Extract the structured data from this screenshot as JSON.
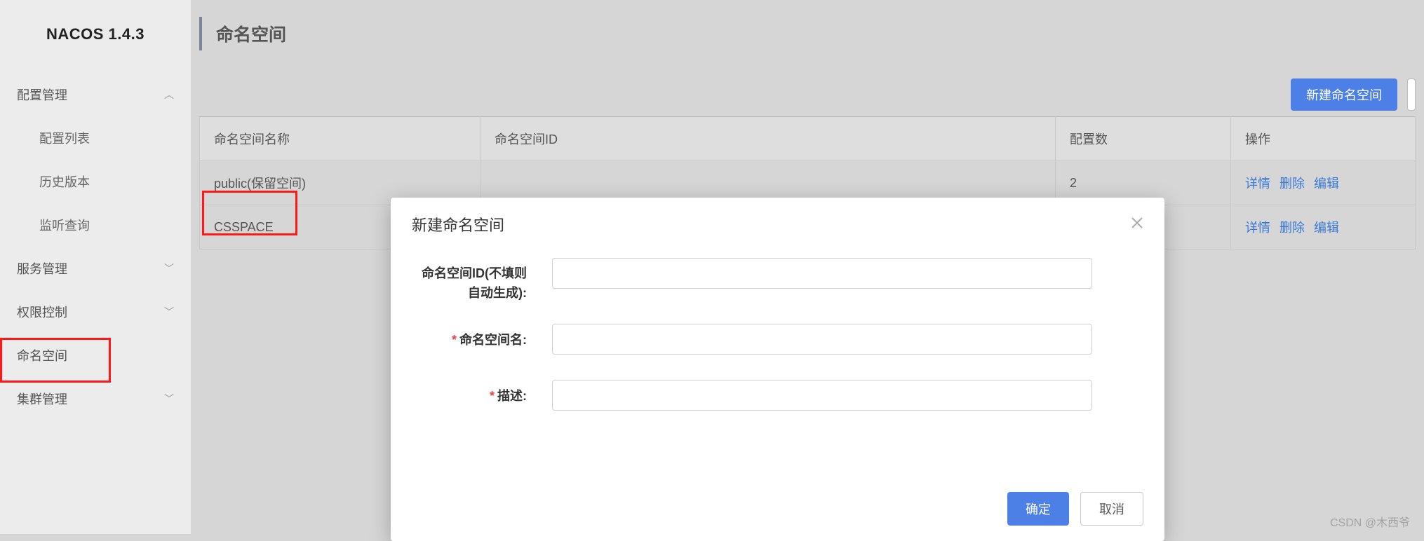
{
  "brand": "NACOS 1.4.3",
  "sidebar": {
    "items": [
      {
        "label": "配置管理",
        "expanded": true
      },
      {
        "label": "服务管理",
        "expanded": false
      },
      {
        "label": "权限控制",
        "expanded": false
      },
      {
        "label": "命名空间",
        "expanded": null
      },
      {
        "label": "集群管理",
        "expanded": false
      }
    ],
    "config_children": [
      {
        "label": "配置列表"
      },
      {
        "label": "历史版本"
      },
      {
        "label": "监听查询"
      }
    ]
  },
  "page": {
    "title": "命名空间",
    "create_button": "新建命名空间"
  },
  "table": {
    "headers": {
      "name": "命名空间名称",
      "id": "命名空间ID",
      "count": "配置数",
      "ops": "操作"
    },
    "rows": [
      {
        "name": "public(保留空间)",
        "id": "",
        "count": "2"
      },
      {
        "name": "CSSPACE",
        "id": "",
        "count": ""
      }
    ],
    "actions": {
      "detail": "详情",
      "delete": "删除",
      "edit": "编辑"
    }
  },
  "modal": {
    "title": "新建命名空间",
    "fields": {
      "id_label": "命名空间ID(不填则自动生成):",
      "name_label": "命名空间名:",
      "desc_label": "描述:"
    },
    "ok": "确定",
    "cancel": "取消"
  },
  "watermark": "CSDN @木西爷"
}
